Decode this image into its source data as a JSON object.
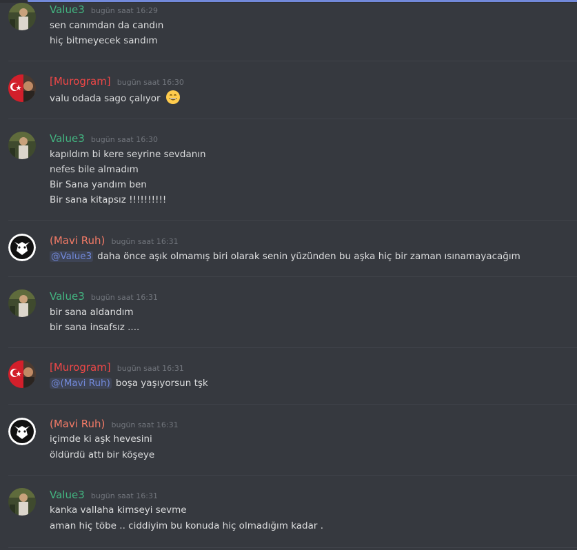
{
  "colors": {
    "value3": "#43b581",
    "murogram": "#f04747",
    "mavi_ruh": "#f47b67",
    "background": "#36393f",
    "mention": "#7289da"
  },
  "messages": [
    {
      "author": "Value3",
      "timestamp": "bugün saat 16:29",
      "avatar": "photo-avatar",
      "lines": [
        "sen canımdan da candın",
        "hiç bitmeyecek sandım"
      ]
    },
    {
      "author": "[Murogram]",
      "timestamp": "bugün saat 16:30",
      "avatar": "turkish-flag-avatar",
      "lines": [
        "valu odada sago çalıyor"
      ],
      "emoji": "grinning-emoji"
    },
    {
      "author": "Value3",
      "timestamp": "bugün saat 16:30",
      "avatar": "photo-avatar",
      "lines": [
        "kapıldım bi kere seyrine sevdanın",
        "nefes bile almadım",
        "Bir Sana yandım ben",
        "Bir sana kitapsız !!!!!!!!!!"
      ]
    },
    {
      "author": "(Mavi Ruh)",
      "timestamp": "bugün saat 16:31",
      "avatar": "wolf-avatar",
      "mention": "@Value3",
      "lines": [
        "daha önce aşık olmamış biri olarak senin yüzünden bu aşka hiç bir zaman ısınamayacağım"
      ]
    },
    {
      "author": "Value3",
      "timestamp": "bugün saat 16:31",
      "avatar": "photo-avatar",
      "lines": [
        "bir sana aldandım",
        "bir sana insafsız ...."
      ]
    },
    {
      "author": "[Murogram]",
      "timestamp": "bugün saat 16:31",
      "avatar": "turkish-flag-avatar",
      "mention": "@(Mavi Ruh)",
      "lines": [
        "boşa yaşıyorsun tşk"
      ]
    },
    {
      "author": "(Mavi Ruh)",
      "timestamp": "bugün saat 16:31",
      "avatar": "wolf-avatar",
      "lines": [
        "içimde ki aşk hevesini",
        "öldürdü attı bir köşeye"
      ]
    },
    {
      "author": "Value3",
      "timestamp": "bugün saat 16:31",
      "avatar": "photo-avatar",
      "lines": [
        "kanka vallaha kimseyi sevme",
        "aman hiç töbe .. ciddiyim bu konuda  hiç olmadığım kadar ."
      ]
    }
  ]
}
